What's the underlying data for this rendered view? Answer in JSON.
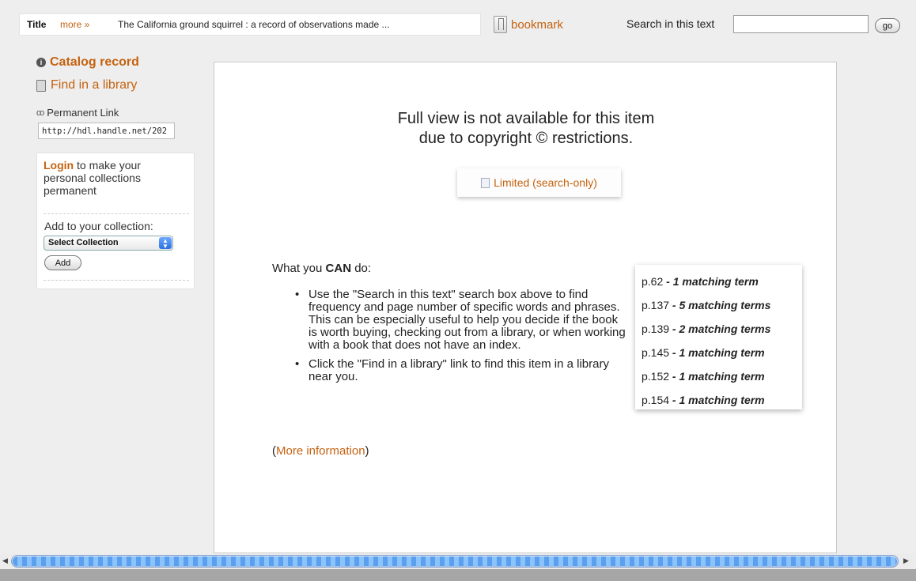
{
  "topbar": {
    "title_label": "Title",
    "more_label": "more »",
    "title_text": "The California ground squirrel : a record of observations made ...",
    "bookmark_label": "bookmark",
    "search_label": "Search in this text",
    "search_value": "",
    "go_label": "go"
  },
  "sidebar": {
    "catalog_record": "Catalog record",
    "find_library": "Find in a library",
    "permanent_link_label": "Permanent Link",
    "permanent_link_value": "http://hdl.handle.net/202",
    "login_link": "Login",
    "login_text": " to make your personal collections permanent",
    "add_label": "Add to your collection:",
    "select_value": "Select Collection",
    "add_button": "Add"
  },
  "main": {
    "notice_line1": "Full view is not available for this item",
    "notice_line2": "due to copyright © restrictions.",
    "limited_label": "Limited (search-only)",
    "what_prefix": "What you ",
    "what_bold": "CAN",
    "what_suffix": " do:",
    "bullets": [
      "Use the \"Search in this text\" search box above to find frequency and page number of specific words and phrases. This can be especially useful to help you decide if the book is worth buying, checking out from a library, or when working with a book that does not have an index.",
      "Click the \"Find in a library\" link to find this item in a library near you."
    ],
    "more_open": "(",
    "more_link": "More information",
    "more_close": ")"
  },
  "matches": [
    {
      "page": "p.62",
      "terms": " - 1 matching term"
    },
    {
      "page": "p.137",
      "terms": " - 5 matching terms"
    },
    {
      "page": "p.139",
      "terms": " - 2 matching terms"
    },
    {
      "page": "p.145",
      "terms": " - 1 matching term"
    },
    {
      "page": "p.152",
      "terms": " - 1 matching term"
    },
    {
      "page": "p.154",
      "terms": " - 1 matching term"
    }
  ],
  "icons": {
    "info": "info-icon",
    "book": "book-icon",
    "chain": "chain-link-icon",
    "bookmark": "bookmark-icon",
    "document": "document-icon"
  },
  "colors": {
    "link": "#c5620f",
    "background": "#eeeeee",
    "scrollbar": "#5aa0ee"
  }
}
